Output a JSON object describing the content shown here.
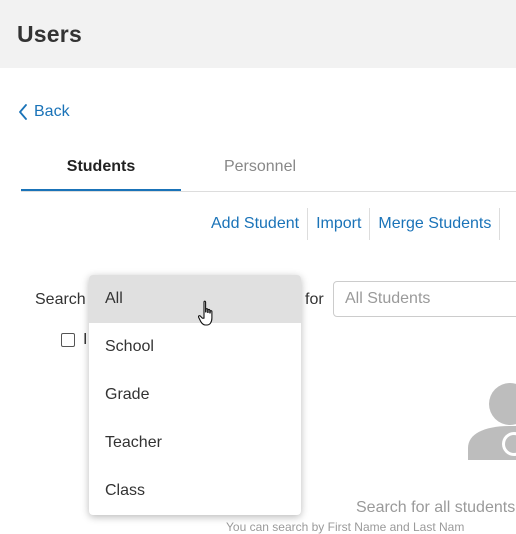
{
  "header": {
    "title": "Users"
  },
  "nav": {
    "back_label": "Back"
  },
  "tabs": [
    {
      "label": "Students",
      "active": true
    },
    {
      "label": "Personnel",
      "active": false
    }
  ],
  "actions": {
    "add_student": "Add Student",
    "import": "Import",
    "merge_students": "Merge Students"
  },
  "search": {
    "label": "Search",
    "for_label": "for",
    "placeholder": "All Students"
  },
  "checkbox": {
    "label_partial": "I"
  },
  "dropdown": {
    "items": [
      "All",
      "School",
      "Grade",
      "Teacher",
      "Class"
    ],
    "hovered_index": 0
  },
  "empty_state": {
    "text": "Search for all students",
    "subtext": "You can search by First Name and Last Nam"
  },
  "colors": {
    "accent": "#1a73b8",
    "header_bg": "#f2f2f2",
    "hover_bg": "#e0e0e0",
    "muted_text": "#9a9a9a"
  },
  "icons": {
    "back": "chevron-left-icon",
    "cursor": "hand-pointer-icon",
    "empty_state": "user-silhouette-icon"
  }
}
